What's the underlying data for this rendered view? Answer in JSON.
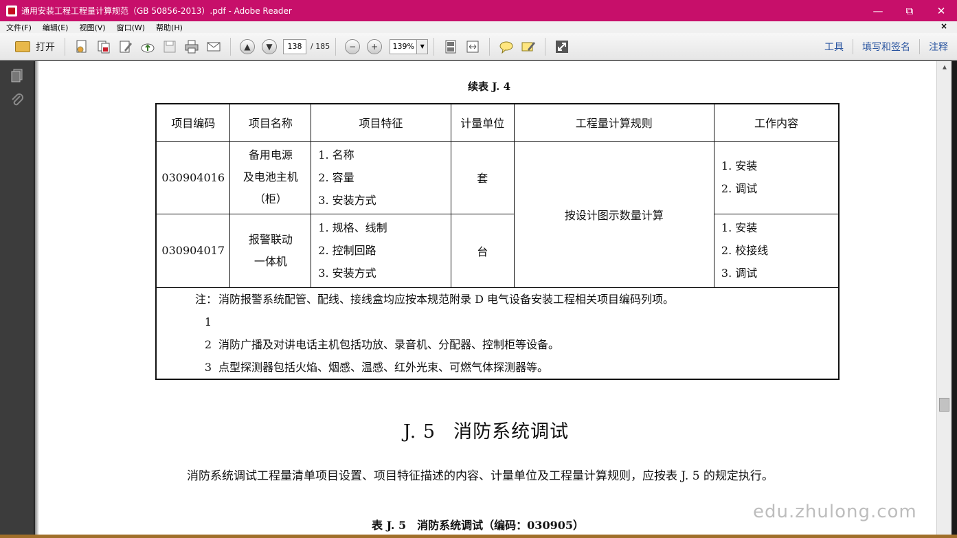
{
  "window": {
    "title": "通用安装工程工程量计算规范（GB 50856-2013）.pdf - Adobe Reader",
    "min_glyph": "—",
    "max_glyph": "⧉",
    "close_glyph": "✕"
  },
  "menu": {
    "items": [
      "文件(F)",
      "编辑(E)",
      "视图(V)",
      "窗口(W)",
      "帮助(H)"
    ],
    "close_doc": "×"
  },
  "toolbar": {
    "open_label": "打开",
    "page_current": "138",
    "page_total": "/ 185",
    "zoom_value": "139%",
    "zoom_out": "−",
    "zoom_in": "+",
    "right_links": [
      "工具",
      "填写和签名",
      "注释"
    ]
  },
  "document": {
    "table_caption": "续表 J. 4",
    "headers": [
      "项目编码",
      "项目名称",
      "项目特征",
      "计量单位",
      "工程量计算规则",
      "工作内容"
    ],
    "rows": [
      {
        "code": "030904016",
        "name": [
          "备用电源",
          "及电池主机",
          "（柜）"
        ],
        "features": [
          "1. 名称",
          "2. 容量",
          "3. 安装方式"
        ],
        "unit": "套",
        "work": [
          "1. 安装",
          "2. 调试"
        ]
      },
      {
        "code": "030904017",
        "name": [
          "报警联动",
          "一体机"
        ],
        "features": [
          "1. 规格、线制",
          "2. 控制回路",
          "3. 安装方式"
        ],
        "unit": "台",
        "work": [
          "1. 安装",
          "2. 校接线",
          "3. 调试"
        ]
      }
    ],
    "calc_rule": "按设计图示数量计算",
    "notes": [
      {
        "key": "注：1",
        "text": "消防报警系统配管、配线、接线盒均应按本规范附录 D 电气设备安装工程相关项目编码列项。"
      },
      {
        "key": "2",
        "text": "消防广播及对讲电话主机包括功放、录音机、分配器、控制柜等设备。"
      },
      {
        "key": "3",
        "text": "点型探测器包括火焰、烟感、温感、红外光束、可燃气体探测器等。"
      }
    ],
    "section_number": "J. 5",
    "section_title": "消防系统调试",
    "paragraph": "消防系统调试工程量清单项目设置、项目特征描述的内容、计量单位及工程量计算规则，应按表 J. 5 的规定执行。",
    "table2_caption": "表 J. 5　消防系统调试（编码：030905）"
  },
  "watermark": "edu.zhulong.com"
}
